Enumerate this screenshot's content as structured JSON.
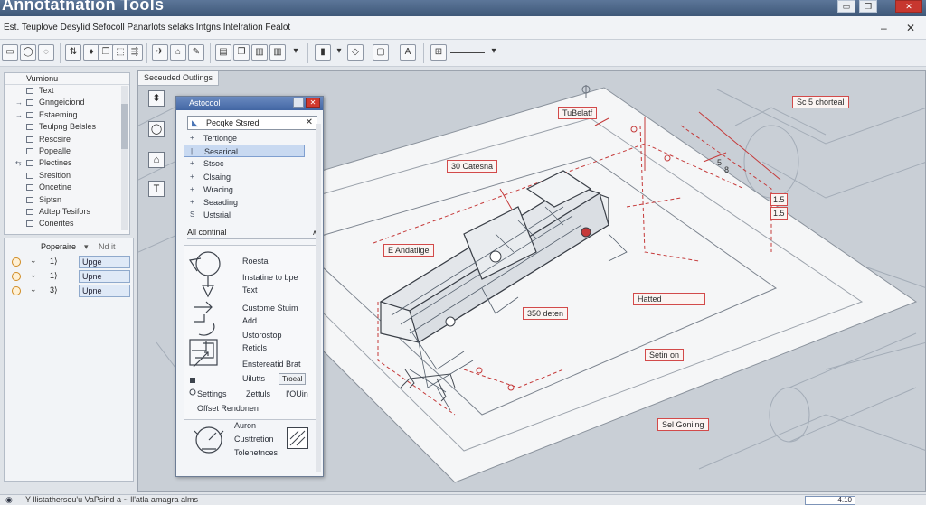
{
  "app": {
    "title": "Annotatnation Tools"
  },
  "menu": {
    "text": "Est. Teuplove Desylid Sefocoll Panarlots selaks Intgns Intelration Fealot",
    "min_glyph": "–",
    "close_glyph": "✕"
  },
  "toolbar": {
    "buttons": [
      "▭",
      "◯",
      "◌",
      "⇅",
      "♦",
      "❐",
      "⬚",
      "⇶",
      "✈",
      "⌂",
      "✎",
      "▤",
      "❐",
      "▥",
      "▾",
      "▮",
      "▾",
      "◇",
      "▢",
      "A",
      "⊞"
    ]
  },
  "left_panel": {
    "header": "Vumionu",
    "items": [
      {
        "mark": "",
        "label": "Text"
      },
      {
        "mark": "→",
        "label": "Gnngeiciond"
      },
      {
        "mark": "→",
        "label": "Estaeming"
      },
      {
        "mark": "",
        "label": "Teulpng Belsles"
      },
      {
        "mark": "",
        "label": "Rescsire"
      },
      {
        "mark": "",
        "label": "Popealle"
      },
      {
        "mark": "⇆",
        "label": "Plectines"
      },
      {
        "mark": "",
        "label": "Sresition"
      },
      {
        "mark": "",
        "label": "Oncetine"
      },
      {
        "mark": "",
        "label": "Siptsn"
      },
      {
        "mark": "",
        "label": "Adtep Tesifors"
      },
      {
        "mark": "",
        "label": "Conerites"
      }
    ]
  },
  "properties_panel": {
    "title": "Poperaire",
    "secondary": "Nd it",
    "rows": [
      {
        "chev": "⌄",
        "mark": "1⟩",
        "value": "Upge"
      },
      {
        "chev": "⌄",
        "mark": "1⟩",
        "value": "Upne"
      },
      {
        "chev": "⌄",
        "mark": "3⟩",
        "value": "Upne"
      }
    ]
  },
  "canvas": {
    "tab": "Seceuded Outlings",
    "tools": [
      "⬍",
      "◯",
      "⌂",
      "T"
    ],
    "callouts": [
      {
        "id": "c1",
        "text": "TuBelatf"
      },
      {
        "id": "c2",
        "text": "Sc 5 chorteal"
      },
      {
        "id": "c3",
        "text": "30 Catesna"
      },
      {
        "id": "c4",
        "text": "E Andatlige"
      },
      {
        "id": "c5",
        "text": "350 deten"
      },
      {
        "id": "c6",
        "text": "Hatted"
      },
      {
        "id": "c7",
        "text": "Setin on"
      },
      {
        "id": "c8",
        "text": "Sel Goniing"
      }
    ],
    "dims": [
      "5",
      "8"
    ],
    "side_marks": [
      "1.5",
      "1.5"
    ]
  },
  "annotation_window": {
    "title": "Astocool",
    "search": "Pecqke Stsred",
    "search_clear": "✕",
    "items": [
      {
        "mark": "+",
        "label": "Tertlonge",
        "selected": false
      },
      {
        "mark": "|",
        "label": "Sesarical",
        "selected": true
      },
      {
        "mark": "+",
        "label": "Stsoc",
        "selected": false
      },
      {
        "mark": "+",
        "label": "Clsaing",
        "selected": false
      },
      {
        "mark": "+",
        "label": "Wracing",
        "selected": false
      },
      {
        "mark": "+",
        "label": "Seaading",
        "selected": false
      },
      {
        "mark": "S",
        "label": "Ustsrial",
        "selected": false
      }
    ],
    "section": "All continal",
    "section_caret": "∧",
    "sub": {
      "labels": [
        "Roestal",
        "Instatine to bpe",
        "Text",
        "Custome Stuim",
        "Add",
        "Ustorostop",
        "Reticls",
        "Enstereatid Brat",
        "Uilutts"
      ],
      "treat_btn": "Troeal",
      "settings": "Settings",
      "settings_b": "Zettuls",
      "settings_c": "I'OUin",
      "offset": "Offset Rendonen"
    },
    "footer": [
      "Auron",
      "Custtretion",
      "Tolenetnces"
    ]
  },
  "status": {
    "text": "Y  llistatherseu'u VaPsind a ~ ll'atla amagra alms",
    "box": "4.10"
  }
}
